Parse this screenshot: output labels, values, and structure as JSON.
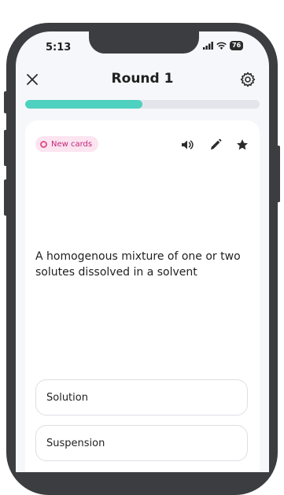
{
  "status_bar": {
    "time": "5:13",
    "battery": "76"
  },
  "header": {
    "title": "Round 1",
    "close_icon": "close-icon",
    "settings_icon": "gear-icon"
  },
  "progress": {
    "fraction": 0.5,
    "color": "#4fd1c0"
  },
  "card": {
    "badge": "New cards",
    "badge_color": "#c2257a",
    "icons": [
      "speaker-icon",
      "pencil-icon",
      "star-icon"
    ],
    "prompt": "A homogenous mixture of one or two solutes dissolved in a solvent",
    "options": [
      "Solution",
      "Suspension"
    ]
  }
}
